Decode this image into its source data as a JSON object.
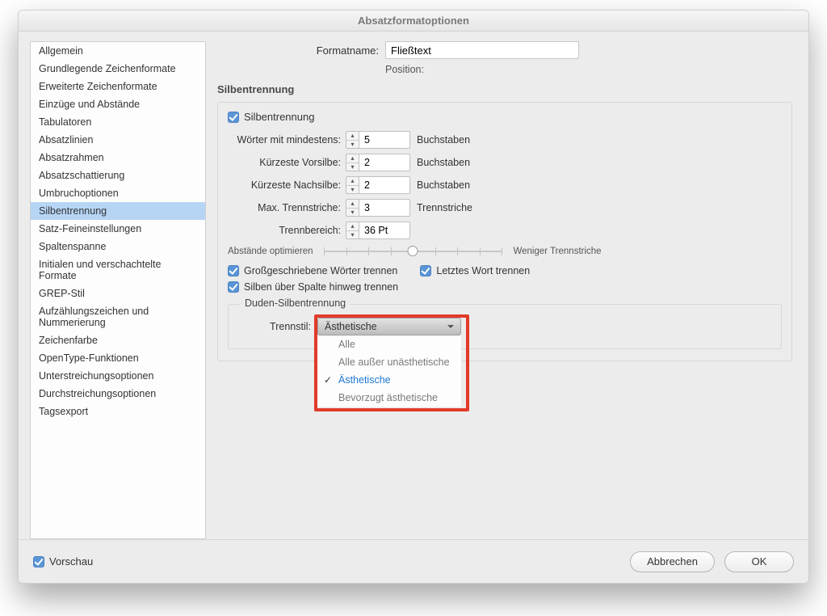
{
  "title": "Absatzformatoptionen",
  "header": {
    "formatname_label": "Formatname:",
    "formatname_value": "Fließtext",
    "position_label": "Position:"
  },
  "sidebar": {
    "items": [
      "Allgemein",
      "Grundlegende Zeichenformate",
      "Erweiterte Zeichenformate",
      "Einzüge und Abstände",
      "Tabulatoren",
      "Absatzlinien",
      "Absatzrahmen",
      "Absatzschattierung",
      "Umbruchoptionen",
      "Silbentrennung",
      "Satz-Feineinstellungen",
      "Spaltenspanne",
      "Initialen und verschachtelte Formate",
      "GREP-Stil",
      "Aufzählungszeichen und Nummerierung",
      "Zeichenfarbe",
      "OpenType-Funktionen",
      "Unterstreichungsoptionen",
      "Durchstreichungsoptionen",
      "Tagsexport"
    ],
    "selected_index": 9
  },
  "section_title": "Silbentrennung",
  "fieldset": {
    "enable_label": "Silbentrennung",
    "rows": [
      {
        "label": "Wörter mit mindestens:",
        "value": "5",
        "unit": "Buchstaben"
      },
      {
        "label": "Kürzeste Vorsilbe:",
        "value": "2",
        "unit": "Buchstaben"
      },
      {
        "label": "Kürzeste Nachsilbe:",
        "value": "2",
        "unit": "Buchstaben"
      },
      {
        "label": "Max. Trennstriche:",
        "value": "3",
        "unit": "Trennstriche"
      },
      {
        "label": "Trennbereich:",
        "value": "36 Pt",
        "unit": ""
      }
    ],
    "slider_left": "Abstände optimieren",
    "slider_right": "Weniger Trennstriche",
    "checks": {
      "gross": "Großgeschriebene Wörter trennen",
      "letztes": "Letztes Wort trennen",
      "spalte": "Silben über Spalte hinweg trennen"
    }
  },
  "duden": {
    "legend": "Duden-Silbentrennung",
    "label": "Trennstil:",
    "selected": "Ästhetische",
    "options": [
      "Alle",
      "Alle außer unästhetische",
      "Ästhetische",
      "Bevorzugt ästhetische"
    ],
    "selected_option_index": 2
  },
  "footer": {
    "vorschau": "Vorschau",
    "cancel": "Abbrechen",
    "ok": "OK"
  }
}
